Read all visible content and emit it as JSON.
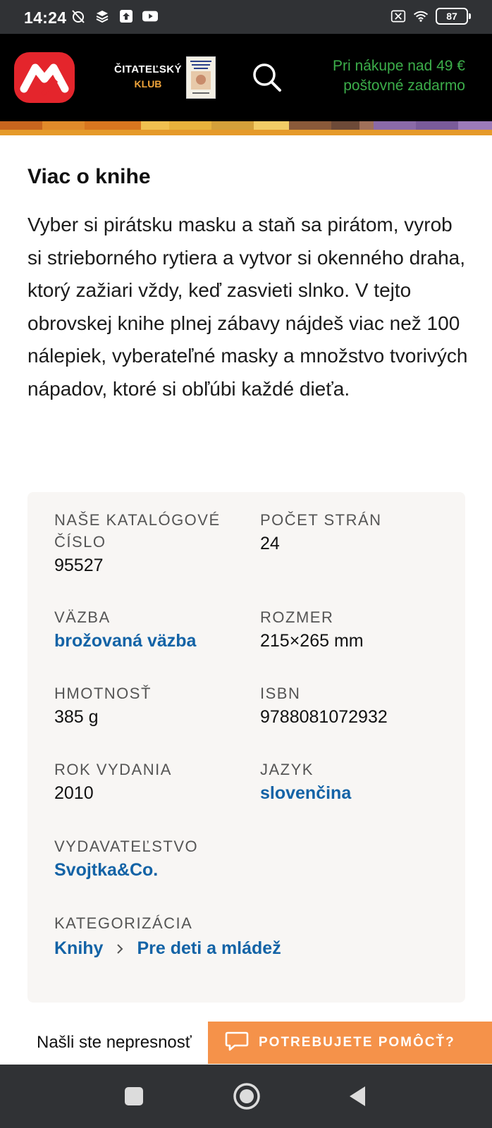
{
  "status_bar": {
    "time": "14:24",
    "battery": "87",
    "icons_left": [
      "alarm-off-icon",
      "layers-icon",
      "upload-icon",
      "youtube-icon"
    ],
    "icons_right": [
      "no-sim-icon",
      "wifi-icon",
      "battery-icon"
    ]
  },
  "header": {
    "logo_icon": "martinus-logo-icon",
    "club_line1": "ČITATEĽSKÝ",
    "club_line2": "KLUB",
    "club_book_icon": "club-book-cover-icon",
    "search_icon": "search-icon",
    "promo_line1": "Pri nákupe nad 49 €",
    "promo_line2": "poštovné zadarmo",
    "promo_color": "#3cae4a"
  },
  "about": {
    "title": "Viac o knihe",
    "description": "Vyber si pirátsku masku a staň sa pirátom, vyrob si strieborného rytiera a vytvor si okenného draha, ktorý zažiari vždy, keď zasvieti slnko. V tejto obrovskej knihe plnej zábavy nájdeš viac než 100 nálepiek, vyberateľné masky a množstvo tvorivých nápadov, ktoré si obľúbi každé dieťa."
  },
  "details": {
    "catalog_label": "NAŠE KATALÓGOVÉ ČÍSLO",
    "catalog_value": "95527",
    "pages_label": "POČET STRÁN",
    "pages_value": "24",
    "binding_label": "VÄZBA",
    "binding_value": "brožovaná väzba",
    "size_label": "ROZMER",
    "size_value": "215×265 mm",
    "weight_label": "HMOTNOSŤ",
    "weight_value": "385 g",
    "isbn_label": "ISBN",
    "isbn_value": "9788081072932",
    "year_label": "ROK VYDANIA",
    "year_value": "2010",
    "language_label": "JAZYK",
    "language_value": "slovenčina",
    "publisher_label": "VYDAVATEĽSTVO",
    "publisher_value": "Svojtka&Co.",
    "category_label": "KATEGORIZÁCIA",
    "category_path": [
      "Knihy",
      "Pre deti a mládež"
    ]
  },
  "footer": {
    "report_text": "Našli ste nepresnosť",
    "help_label": "POTREBUJETE POMÔCŤ?",
    "help_color": "#f5924a"
  },
  "nav": {
    "recents_icon": "square-icon",
    "home_icon": "home-circle-icon",
    "back_icon": "back-triangle-icon"
  },
  "colors": {
    "link": "#1363a6",
    "card_bg": "#f8f6f4",
    "brand_red": "#e4252c"
  }
}
